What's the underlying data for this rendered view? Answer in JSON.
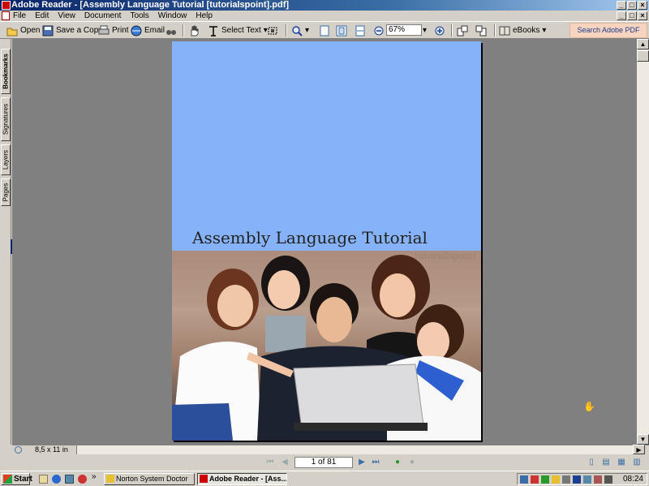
{
  "window": {
    "title": "Adobe Reader - [Assembly Language Tutorial [tutorialspoint].pdf]",
    "controls": [
      "_",
      "□",
      "×"
    ]
  },
  "menu": {
    "items": [
      "File",
      "Edit",
      "View",
      "Document",
      "Tools",
      "Window",
      "Help"
    ]
  },
  "toolbar": {
    "open_label": "Open",
    "save_copy_label": "Save a Copy",
    "print_label": "Print",
    "email_label": "Email",
    "select_text_label": "Select Text",
    "zoom_value": "67%",
    "ebooks_label": "eBooks",
    "search_pdf_label": "Search Adobe PDF files"
  },
  "side_tabs": [
    "Bookmarks",
    "Signatures",
    "Layers",
    "Pages"
  ],
  "document": {
    "title": "Assembly Language Tutorial",
    "watermark": "tutorialspoint",
    "page_size": "8,5 x 11 in"
  },
  "navigation": {
    "page_indicator": "1 of 81"
  },
  "taskbar": {
    "start_label": "Start",
    "tasks": [
      "Norton System Doctor",
      "Adobe Reader - [Ass..."
    ],
    "clock": "08:24",
    "chevron": "»"
  },
  "colors": {
    "titlebar": "#0a246a",
    "page_background": "#85b2f8",
    "workspace": "#808080",
    "search_button": "#f7d4bf"
  },
  "icons": [
    "open-icon",
    "save-icon",
    "print-icon",
    "email-icon",
    "search-binoculars-icon",
    "hand-tool-icon",
    "select-text-icon",
    "snapshot-icon",
    "zoom-in-icon",
    "fit-page-icon",
    "actual-size-icon",
    "fit-width-icon",
    "zoom-out-minus-icon",
    "zoom-plus-icon",
    "rotate-icon",
    "ebooks-icon"
  ]
}
